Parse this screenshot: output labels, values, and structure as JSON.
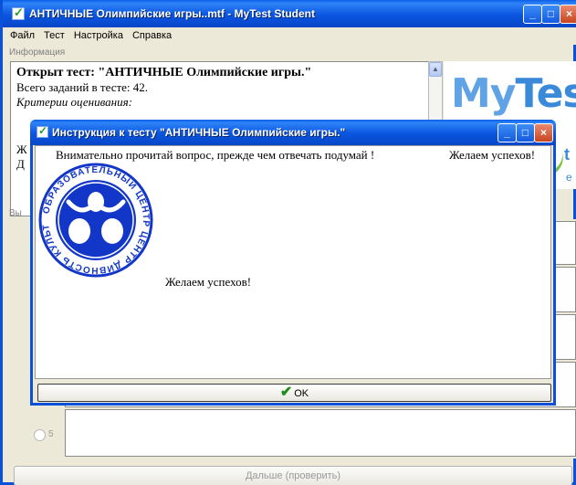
{
  "main_window": {
    "title": "АНТИЧНЫЕ Олимпийские игры..mtf - MyTest Student",
    "controls": {
      "minimize": "_",
      "maximize": "□",
      "close": "×"
    }
  },
  "menu": [
    "Файл",
    "Тест",
    "Настройка",
    "Справка"
  ],
  "info": {
    "label": "Информация",
    "line1": "Открыт тест: \"АНТИЧНЫЕ Олимпийские игры.\"",
    "line2": "Всего заданий в тесте: 42.",
    "line3": "Критерии оценивания:",
    "line4": "Ж",
    "line5": "Д"
  },
  "logo": {
    "text_my": "My",
    "text_test": "Test",
    "partial_t": "t",
    "partial_e": "e"
  },
  "choices_label": "Вы",
  "answers": [
    {
      "number": "5"
    }
  ],
  "next_button": "Дальше (проверить)",
  "dialog": {
    "title": "Инструкция к тесту \"АНТИЧНЫЕ Олимпийские игры.\"",
    "instruction": "Внимательно прочитай вопрос, прежде чем отвечать подумай !",
    "wish_top": "Желаем успехов!",
    "wish": "Желаем успехов!",
    "seal_text": "ОБРАЗОВАТЕЛЬНЫЙ ЦЕНТР ЦЕНТР ДИВНОСТЬ КУЛЬТУРА",
    "ok_label": "OK"
  },
  "colors": {
    "titlebar": "#0a55e0",
    "seal_blue": "#1237c8",
    "logo_blue": "#3a8ad9",
    "ok_check": "#1c8c1c"
  }
}
